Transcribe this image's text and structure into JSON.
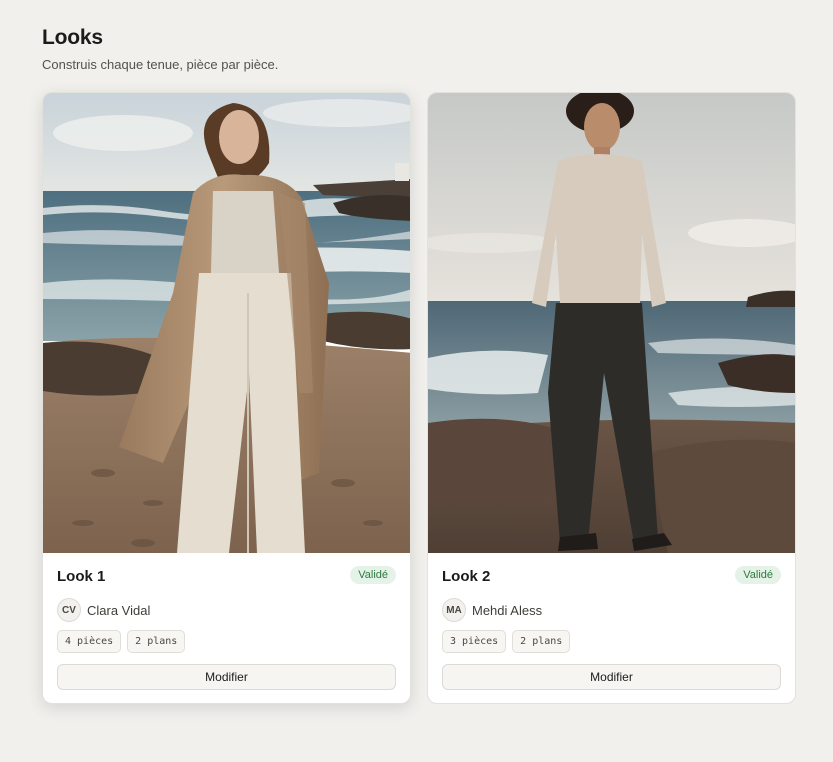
{
  "header": {
    "title": "Looks",
    "subtitle": "Construis chaque tenue, pièce par pièce."
  },
  "looks": [
    {
      "title": "Look 1",
      "status": "Validé",
      "owner_initials": "CV",
      "owner_name": "Clara Vidal",
      "pieces": "4 pièces",
      "plans": "2 plans",
      "edit_label": "Modifier"
    },
    {
      "title": "Look 2",
      "status": "Validé",
      "owner_initials": "MA",
      "owner_name": "Mehdi Aless",
      "pieces": "3 pièces",
      "plans": "2 plans",
      "edit_label": "Modifier"
    }
  ],
  "colors": {
    "background": "#f1f0ed",
    "status_bg": "#e4f2e7",
    "status_text": "#2f7a3e"
  }
}
